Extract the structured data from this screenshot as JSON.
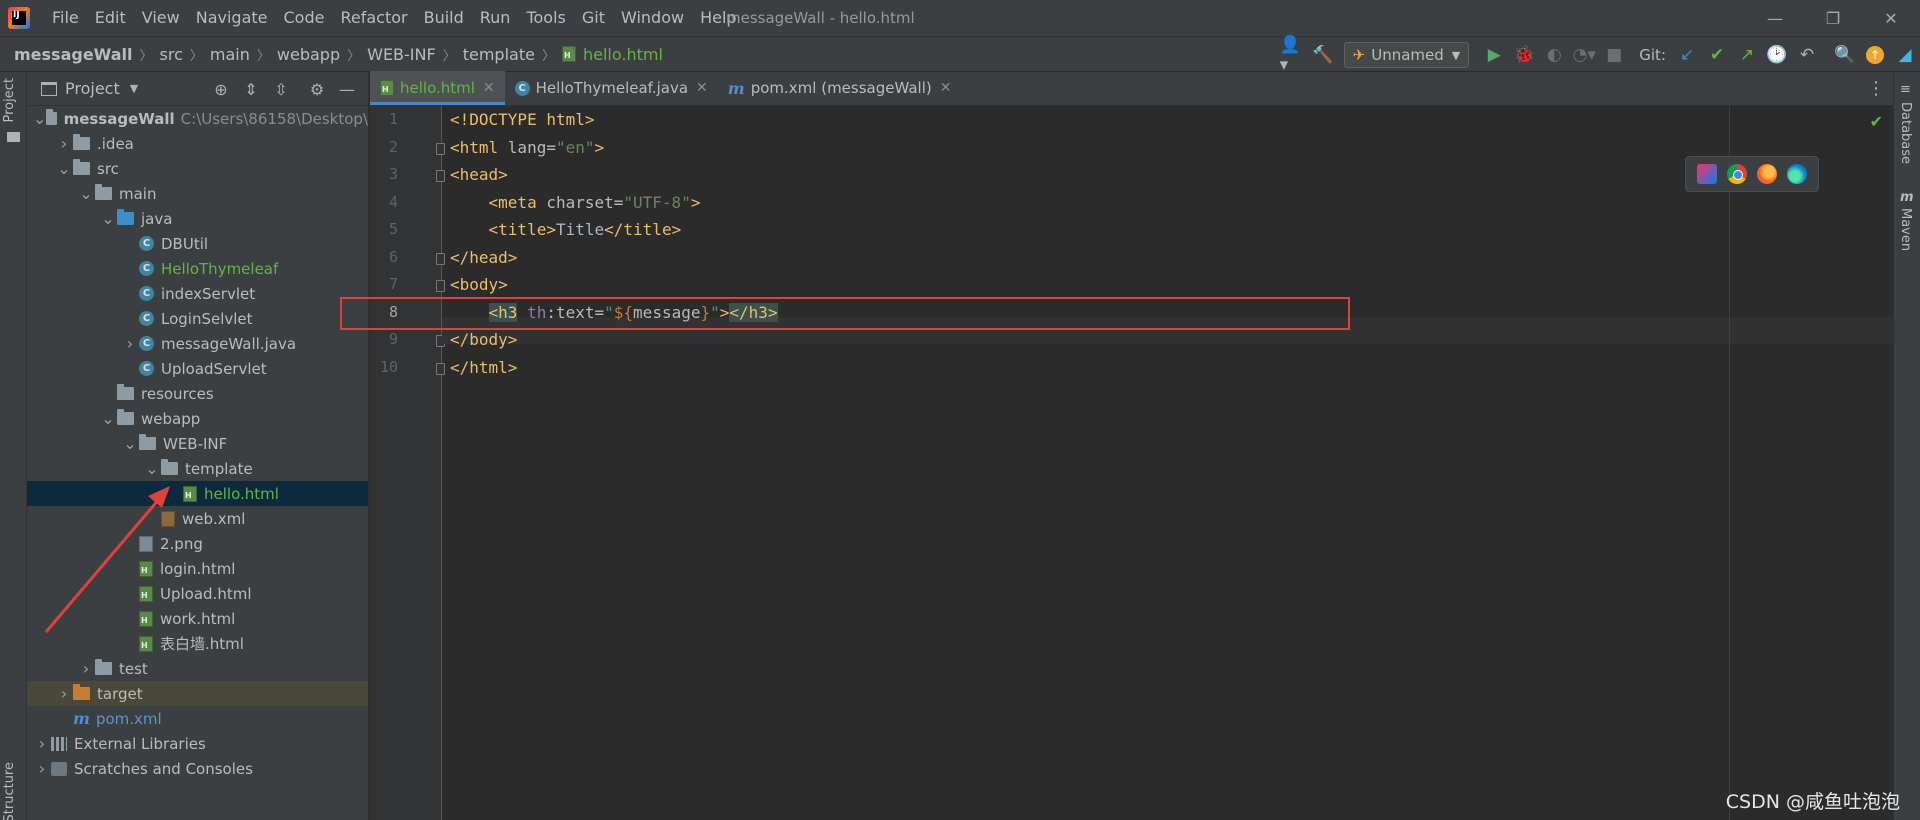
{
  "window": {
    "menu": [
      "File",
      "Edit",
      "View",
      "Navigate",
      "Code",
      "Refactor",
      "Build",
      "Run",
      "Tools",
      "Git",
      "Window",
      "Help"
    ],
    "title": "messageWall - hello.html",
    "controls": {
      "minimize": "—",
      "restore": "❐",
      "close": "✕"
    }
  },
  "breadcrumb": [
    "messageWall",
    "src",
    "main",
    "webapp",
    "WEB-INF",
    "template",
    "hello.html"
  ],
  "toolbar": {
    "run_config": "Unnamed",
    "git_label": "Git:"
  },
  "project_panel": {
    "title": "Project",
    "tree": [
      {
        "depth": 0,
        "arrow": "down",
        "icon": "module-folder",
        "label": "messageWall",
        "extra": "C:\\Users\\86158\\Desktop\\",
        "style": "bold"
      },
      {
        "depth": 1,
        "arrow": "right",
        "icon": "folder",
        "label": ".idea"
      },
      {
        "depth": 1,
        "arrow": "down",
        "icon": "folder",
        "label": "src"
      },
      {
        "depth": 2,
        "arrow": "down",
        "icon": "folder",
        "label": "main"
      },
      {
        "depth": 3,
        "arrow": "down",
        "icon": "folder-blue",
        "label": "java"
      },
      {
        "depth": 4,
        "arrow": "none",
        "icon": "class",
        "label": "DBUtil"
      },
      {
        "depth": 4,
        "arrow": "none",
        "icon": "class",
        "label": "HelloThymeleaf",
        "style": "green"
      },
      {
        "depth": 4,
        "arrow": "none",
        "icon": "class",
        "label": "indexServlet"
      },
      {
        "depth": 4,
        "arrow": "none",
        "icon": "class",
        "label": "LoginSelvlet"
      },
      {
        "depth": 4,
        "arrow": "right",
        "icon": "class",
        "label": "messageWall.java"
      },
      {
        "depth": 4,
        "arrow": "none",
        "icon": "class",
        "label": "UploadServlet"
      },
      {
        "depth": 3,
        "arrow": "none",
        "icon": "folder",
        "label": "resources"
      },
      {
        "depth": 3,
        "arrow": "down",
        "icon": "folder",
        "label": "webapp"
      },
      {
        "depth": 4,
        "arrow": "down",
        "icon": "folder",
        "label": "WEB-INF"
      },
      {
        "depth": 5,
        "arrow": "down",
        "icon": "folder",
        "label": "template"
      },
      {
        "depth": 6,
        "arrow": "none",
        "icon": "html",
        "label": "hello.html",
        "style": "green",
        "selected": true
      },
      {
        "depth": 5,
        "arrow": "none",
        "icon": "xml",
        "label": "web.xml"
      },
      {
        "depth": 4,
        "arrow": "none",
        "icon": "image",
        "label": "2.png"
      },
      {
        "depth": 4,
        "arrow": "none",
        "icon": "html",
        "label": "login.html"
      },
      {
        "depth": 4,
        "arrow": "none",
        "icon": "html",
        "label": "Upload.html"
      },
      {
        "depth": 4,
        "arrow": "none",
        "icon": "html",
        "label": "work.html"
      },
      {
        "depth": 4,
        "arrow": "none",
        "icon": "html",
        "label": "表白墙.html"
      },
      {
        "depth": 2,
        "arrow": "right",
        "icon": "folder",
        "label": "test"
      },
      {
        "depth": 1,
        "arrow": "right",
        "icon": "folder-orange",
        "label": "target",
        "excluded": true
      },
      {
        "depth": 1,
        "arrow": "none",
        "icon": "maven",
        "label": "pom.xml",
        "style": "blue"
      },
      {
        "depth": 0,
        "arrow": "right",
        "icon": "libraries",
        "label": "External Libraries"
      },
      {
        "depth": 0,
        "arrow": "right",
        "icon": "scratches",
        "label": "Scratches and Consoles"
      }
    ]
  },
  "left_stripe": {
    "project": "Project",
    "structure": "Structure"
  },
  "right_stripe": {
    "database": "Database",
    "maven": "Maven"
  },
  "editor": {
    "tabs": [
      {
        "label": "hello.html",
        "icon": "html",
        "active": true
      },
      {
        "label": "HelloThymeleaf.java",
        "icon": "class",
        "active": false
      },
      {
        "label": "pom.xml (messageWall)",
        "icon": "maven",
        "active": false
      }
    ],
    "current_line": 8,
    "lines": [
      {
        "n": "1",
        "tokens": [
          {
            "t": "<!DOCTYPE html>",
            "c": "tag"
          }
        ]
      },
      {
        "n": "2",
        "tokens": [
          {
            "t": "<html ",
            "c": "tag"
          },
          {
            "t": "lang=",
            "c": "attr"
          },
          {
            "t": "\"en\"",
            "c": "str"
          },
          {
            "t": ">",
            "c": "tag"
          }
        ]
      },
      {
        "n": "3",
        "tokens": [
          {
            "t": "<head>",
            "c": "tag"
          }
        ]
      },
      {
        "n": "4",
        "tokens": [
          {
            "t": "    ",
            "c": "txt"
          },
          {
            "t": "<meta ",
            "c": "tag"
          },
          {
            "t": "charset=",
            "c": "attr"
          },
          {
            "t": "\"UTF-8\"",
            "c": "str"
          },
          {
            "t": ">",
            "c": "tag"
          }
        ]
      },
      {
        "n": "5",
        "tokens": [
          {
            "t": "    ",
            "c": "txt"
          },
          {
            "t": "<title>",
            "c": "tag"
          },
          {
            "t": "Title",
            "c": "txt"
          },
          {
            "t": "</title>",
            "c": "tag"
          }
        ]
      },
      {
        "n": "6",
        "tokens": [
          {
            "t": "</head>",
            "c": "tag"
          }
        ]
      },
      {
        "n": "7",
        "tokens": [
          {
            "t": "<body>",
            "c": "tag"
          }
        ]
      },
      {
        "n": "8",
        "tokens": [
          {
            "t": "    ",
            "c": "txt"
          },
          {
            "t": "<h3",
            "c": "tag-hl"
          },
          {
            "t": " ",
            "c": "txt"
          },
          {
            "t": "th",
            "c": "th"
          },
          {
            "t": ":text=",
            "c": "attr"
          },
          {
            "t": "\"",
            "c": "str"
          },
          {
            "t": "${",
            "c": "exp"
          },
          {
            "t": "message",
            "c": "attr"
          },
          {
            "t": "}",
            "c": "exp"
          },
          {
            "t": "\"",
            "c": "str"
          },
          {
            "t": ">",
            "c": "tag"
          },
          {
            "t": "</h3>",
            "c": "tag-hl"
          }
        ]
      },
      {
        "n": "9",
        "tokens": [
          {
            "t": "</body>",
            "c": "tag"
          }
        ]
      },
      {
        "n": "10",
        "tokens": [
          {
            "t": "</html>",
            "c": "tag"
          }
        ]
      }
    ]
  },
  "watermark": "CSDN @咸鱼吐泡泡"
}
